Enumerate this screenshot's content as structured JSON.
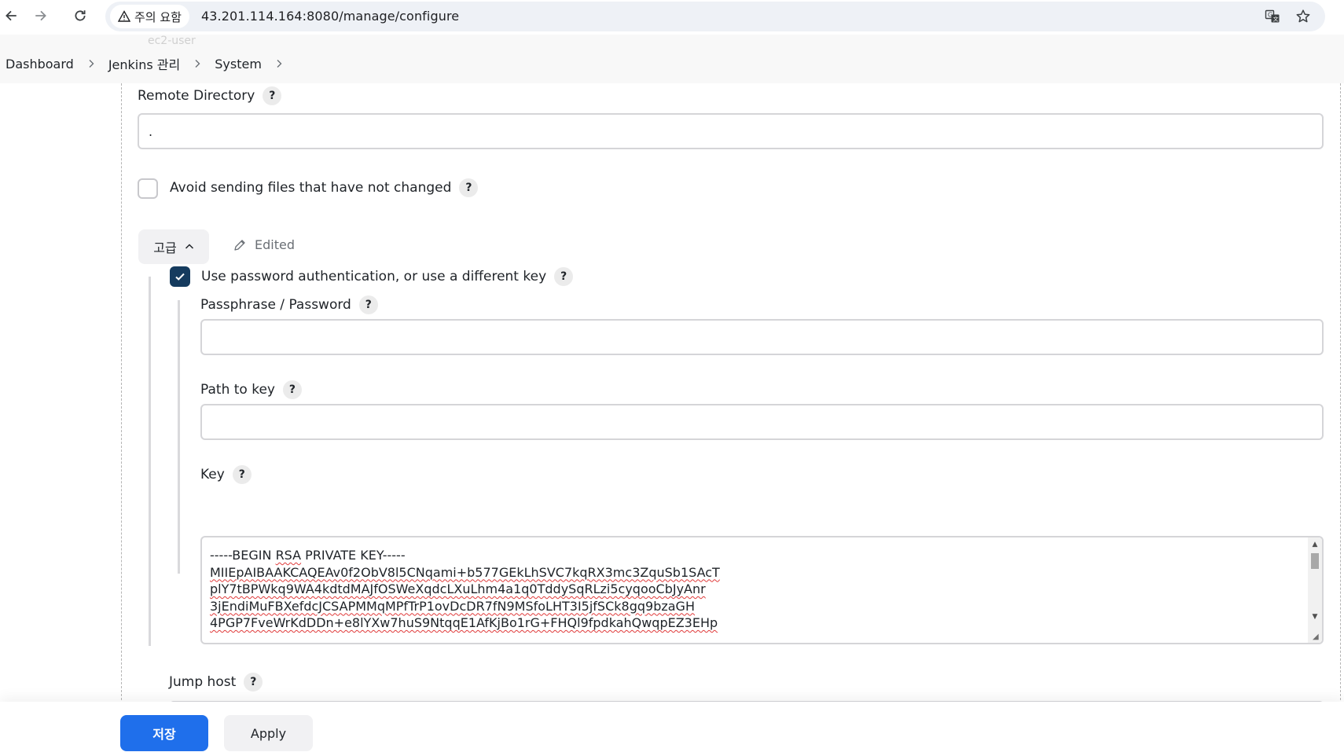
{
  "browser": {
    "security_label": "주의 요함",
    "url": "43.201.114.164:8080/manage/configure"
  },
  "header": {
    "faded_value": "ec2-user",
    "breadcrumb": [
      {
        "label": "Dashboard"
      },
      {
        "label": "Jenkins 관리"
      },
      {
        "label": "System"
      }
    ]
  },
  "form": {
    "remote_directory": {
      "label": "Remote Directory",
      "value": "."
    },
    "avoid_sending": {
      "label": "Avoid sending files that have not changed",
      "checked": false
    },
    "advanced": {
      "label": "고급",
      "edited_label": "Edited"
    },
    "use_password": {
      "label": "Use password authentication, or use a different key",
      "checked": true
    },
    "passphrase": {
      "label": "Passphrase / Password",
      "value": ""
    },
    "path_to_key": {
      "label": "Path to key",
      "value": ""
    },
    "key": {
      "label": "Key",
      "lines": [
        "-----BEGIN RSA PRIVATE KEY-----",
        "MIIEpAIBAAKCAQEAv0f2ObV8l5CNqami+b577GEkLhSVC7kqRX3mc3ZquSb1SAcT",
        "plY7tBPWkq9WA4kdtdMAJfOSWeXqdcLXuLhm4a1q0TddySqRLzi5cyqooCbJyAnr",
        "3jEndiMuFBXefdcJCSAPMMqMPfTrP1ovDcDR7fN9MSfoLHT3I5jfSCk8gq9bzaGH",
        "4PGP7FveWrKdDDn+e8lYXw7huS9NtqqE1AfKjBo1rG+FHQl9fpdkahQwqpEZ3EHp"
      ]
    },
    "jump_host": {
      "label": "Jump host"
    }
  },
  "help_symbol": "?",
  "actions": {
    "save_label": "저장",
    "apply_label": "Apply"
  },
  "colors": {
    "primary": "#1f6feb",
    "checkbox_checked": "#153b5e",
    "spell_error": "#e03a3a"
  }
}
